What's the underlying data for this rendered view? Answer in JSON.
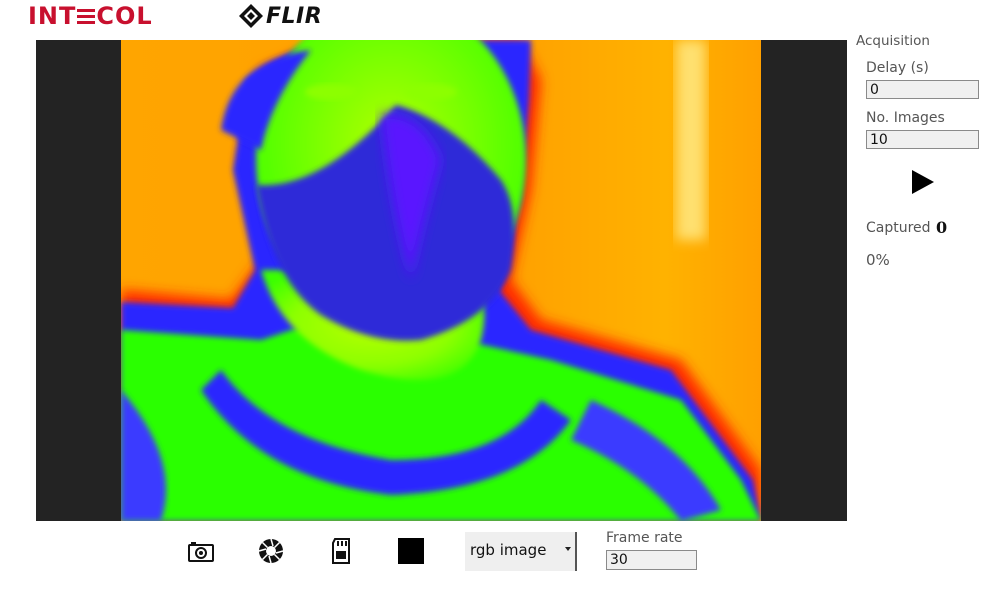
{
  "header": {
    "brand_left": "INTECOL",
    "brand_left_parts": [
      "INT",
      "COL"
    ],
    "brand_right": "FLIR"
  },
  "viewer": {
    "content": "thermal-camera-feed",
    "palette": [
      "#2200ff",
      "#3a3aff",
      "#2bff00",
      "#aaff00",
      "#ffee00",
      "#ffa500",
      "#ff2a00"
    ]
  },
  "acquisition": {
    "title": "Acquisition",
    "delay_label": "Delay (s)",
    "delay_value": "0",
    "images_label": "No. Images",
    "images_value": "10",
    "start_icon": "play-icon",
    "captured_label": "Captured",
    "captured_value": "0",
    "progress_text": "0%",
    "progress": 0
  },
  "toolbar": {
    "snapshot_icon": "camera-icon",
    "shutter_icon": "aperture-icon",
    "save_icon": "sd-card-icon",
    "stop_icon": "stop-icon",
    "mode_value": "rgb image",
    "frame_rate_label": "Frame rate",
    "frame_rate_value": "30"
  },
  "colors": {
    "brand_red": "#c8102e",
    "viewer_bg": "#232323",
    "input_bg": "#f0f0f0"
  }
}
